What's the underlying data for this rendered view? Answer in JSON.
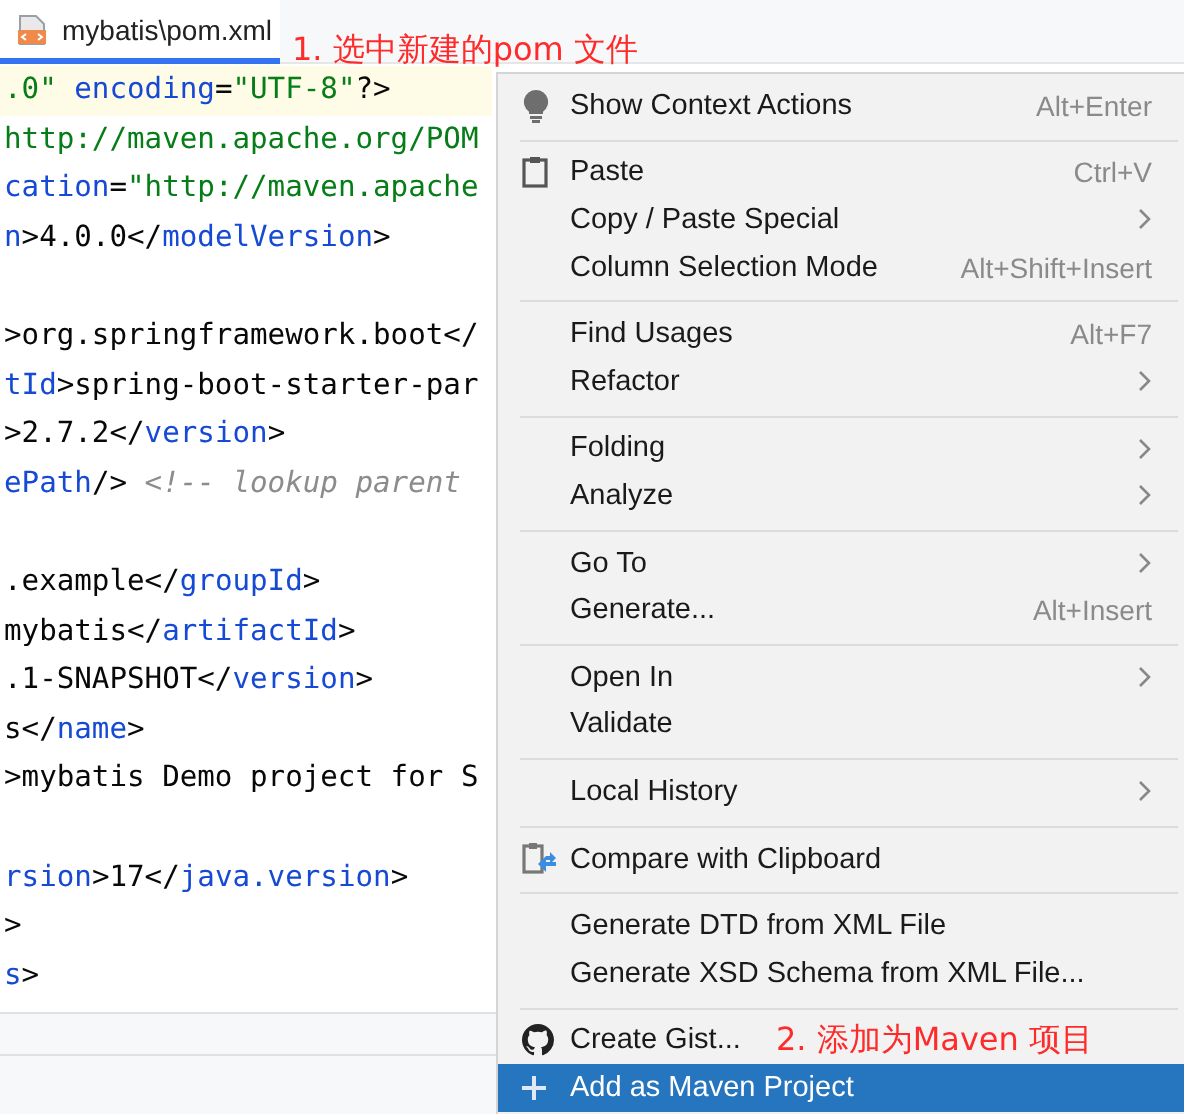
{
  "tab": {
    "label": "mybatis\\pom.xml",
    "selected": true
  },
  "editor": {
    "lines": [
      {
        "current": true,
        "tokens": [
          {
            "kind": "string",
            "text": ".0\""
          },
          {
            "kind": "attr",
            "text": " encoding"
          },
          {
            "kind": "text",
            "text": "="
          },
          {
            "kind": "string",
            "text": "\"UTF-8\""
          },
          {
            "kind": "text",
            "text": "?>"
          }
        ]
      },
      {
        "current": false,
        "tokens": [
          {
            "kind": "string",
            "text": "http://maven.apache.org/POM"
          }
        ]
      },
      {
        "current": false,
        "tokens": [
          {
            "kind": "attr",
            "text": "cation"
          },
          {
            "kind": "text",
            "text": "="
          },
          {
            "kind": "string",
            "text": "\"http://maven.apache"
          }
        ]
      },
      {
        "current": false,
        "tokens": [
          {
            "kind": "attr",
            "text": "n"
          },
          {
            "kind": "text",
            "text": ">4.0.0</"
          },
          {
            "kind": "attr",
            "text": "modelVersion"
          },
          {
            "kind": "text",
            "text": ">"
          }
        ]
      },
      {
        "current": false
      },
      {
        "current": false,
        "tokens": [
          {
            "kind": "text",
            "text": ">org.springframework.boot</"
          }
        ]
      },
      {
        "current": false,
        "tokens": [
          {
            "kind": "attr",
            "text": "tId"
          },
          {
            "kind": "text",
            "text": ">spring-boot-starter-par"
          }
        ]
      },
      {
        "current": false,
        "tokens": [
          {
            "kind": "text",
            "text": ">2.7.2</"
          },
          {
            "kind": "attr",
            "text": "version"
          },
          {
            "kind": "text",
            "text": ">"
          }
        ]
      },
      {
        "current": false,
        "tokens": [
          {
            "kind": "attr",
            "text": "ePath"
          },
          {
            "kind": "text",
            "text": "/> "
          },
          {
            "kind": "comment",
            "text": "<!-- lookup parent"
          }
        ]
      },
      {
        "current": false
      },
      {
        "current": false,
        "tokens": [
          {
            "kind": "text",
            "text": ".example</"
          },
          {
            "kind": "attr",
            "text": "groupId"
          },
          {
            "kind": "text",
            "text": ">"
          }
        ]
      },
      {
        "current": false,
        "tokens": [
          {
            "kind": "text",
            "text": "mybatis</"
          },
          {
            "kind": "attr",
            "text": "artifactId"
          },
          {
            "kind": "text",
            "text": ">"
          }
        ]
      },
      {
        "current": false,
        "tokens": [
          {
            "kind": "text",
            "text": ".1-SNAPSHOT</"
          },
          {
            "kind": "attr",
            "text": "version"
          },
          {
            "kind": "text",
            "text": ">"
          }
        ]
      },
      {
        "current": false,
        "tokens": [
          {
            "kind": "text",
            "text": "s</"
          },
          {
            "kind": "attr",
            "text": "name"
          },
          {
            "kind": "text",
            "text": ">"
          }
        ]
      },
      {
        "current": false,
        "tokens": [
          {
            "kind": "text",
            "text": ">mybatis Demo project for S"
          }
        ]
      },
      {
        "current": false
      },
      {
        "current": false,
        "tokens": [
          {
            "kind": "attr",
            "text": "rsion"
          },
          {
            "kind": "text",
            "text": ">17</"
          },
          {
            "kind": "attr",
            "text": "java.version"
          },
          {
            "kind": "text",
            "text": ">"
          }
        ]
      },
      {
        "current": false,
        "tokens": [
          {
            "kind": "text",
            "text": ">"
          }
        ]
      },
      {
        "current": false,
        "tokens": [
          {
            "kind": "attr",
            "text": "s"
          },
          {
            "kind": "text",
            "text": ">"
          }
        ]
      }
    ]
  },
  "context_menu": {
    "groups": [
      [
        {
          "label": "Show Context Actions",
          "shortcut": "Alt+Enter",
          "submenu": false,
          "selected": false
        }
      ],
      [
        {
          "label": "Paste",
          "shortcut": "Ctrl+V",
          "submenu": false,
          "selected": false
        },
        {
          "label": "Copy / Paste Special",
          "submenu": true,
          "selected": false
        },
        {
          "label": "Column Selection Mode",
          "shortcut": "Alt+Shift+Insert",
          "submenu": false,
          "selected": false
        }
      ],
      [
        {
          "label": "Find Usages",
          "shortcut": "Alt+F7",
          "submenu": false,
          "selected": false
        },
        {
          "label": "Refactor",
          "submenu": true,
          "selected": false
        }
      ],
      [
        {
          "label": "Folding",
          "submenu": true,
          "selected": false
        },
        {
          "label": "Analyze",
          "submenu": true,
          "selected": false
        }
      ],
      [
        {
          "label": "Go To",
          "submenu": true,
          "selected": false
        },
        {
          "label": "Generate...",
          "shortcut": "Alt+Insert",
          "submenu": false,
          "selected": false
        }
      ],
      [
        {
          "label": "Open In",
          "submenu": true,
          "selected": false
        },
        {
          "label": "Validate",
          "submenu": false,
          "selected": false
        }
      ],
      [
        {
          "label": "Local History",
          "submenu": true,
          "selected": false
        }
      ],
      [
        {
          "label": "Compare with Clipboard",
          "submenu": false,
          "selected": false
        }
      ],
      [
        {
          "label": "Generate DTD from XML File",
          "submenu": false,
          "selected": false
        },
        {
          "label": "Generate XSD Schema from XML File...",
          "submenu": false,
          "selected": false
        }
      ],
      [
        {
          "label": "Create Gist...",
          "submenu": false,
          "selected": false
        },
        {
          "label": "Add as Maven Project",
          "submenu": false,
          "selected": true
        }
      ]
    ]
  },
  "annotations": [
    "1. 选中新建的pom 文件",
    "2. 添加为Maven 项目"
  ]
}
